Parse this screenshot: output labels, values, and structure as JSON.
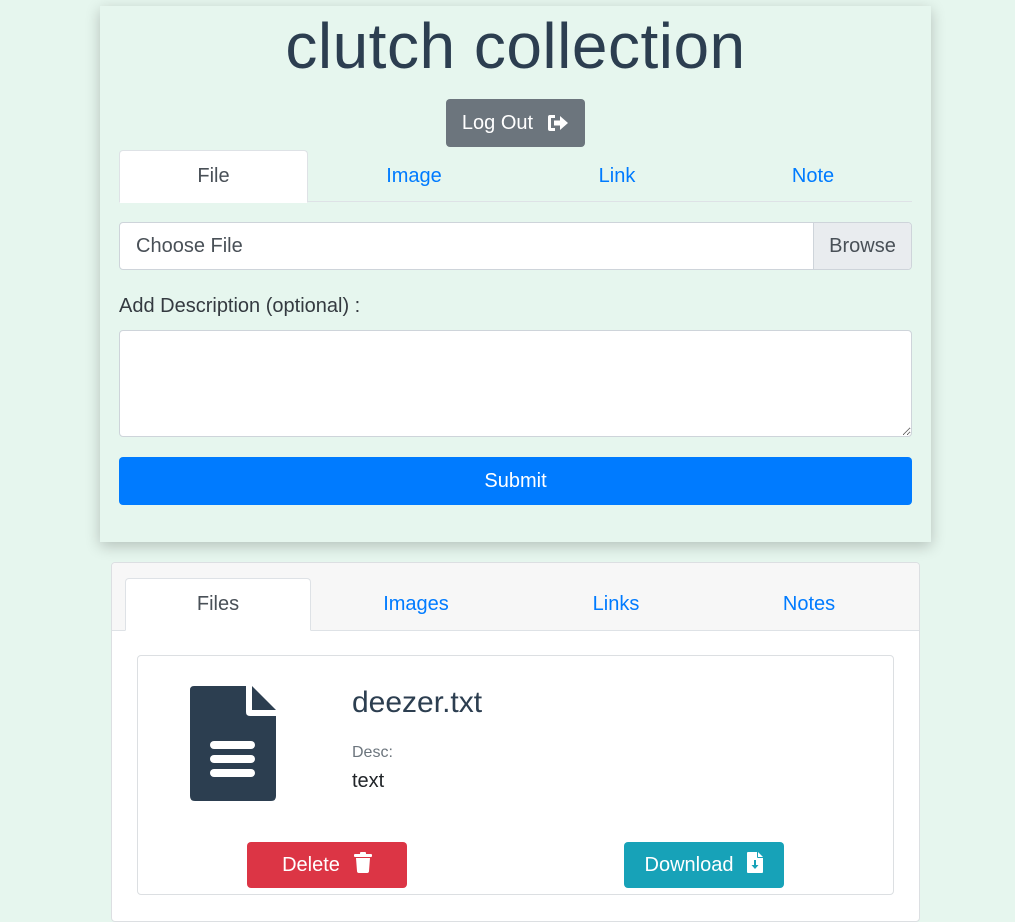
{
  "app": {
    "title": "clutch collection",
    "logout_label": "Log Out"
  },
  "upload": {
    "tabs": [
      {
        "label": "File",
        "active": true
      },
      {
        "label": "Image",
        "active": false
      },
      {
        "label": "Link",
        "active": false
      },
      {
        "label": "Note",
        "active": false
      }
    ],
    "file_input": {
      "placeholder": "Choose File",
      "browse_label": "Browse"
    },
    "description_label": "Add Description (optional) :",
    "description_value": "",
    "submit_label": "Submit"
  },
  "collection": {
    "tabs": [
      {
        "label": "Files",
        "active": true
      },
      {
        "label": "Images",
        "active": false
      },
      {
        "label": "Links",
        "active": false
      },
      {
        "label": "Notes",
        "active": false
      }
    ],
    "items": [
      {
        "icon": "file-text-icon",
        "name": "deezer.txt",
        "desc_caption": "Desc:",
        "desc": "text",
        "delete_label": "Delete",
        "download_label": "Download"
      }
    ]
  },
  "colors": {
    "background": "#e6f6ee",
    "primary": "#007bff",
    "secondary": "#6c757d",
    "danger": "#dc3545",
    "info": "#17a2b8",
    "title": "#2c3e50"
  }
}
